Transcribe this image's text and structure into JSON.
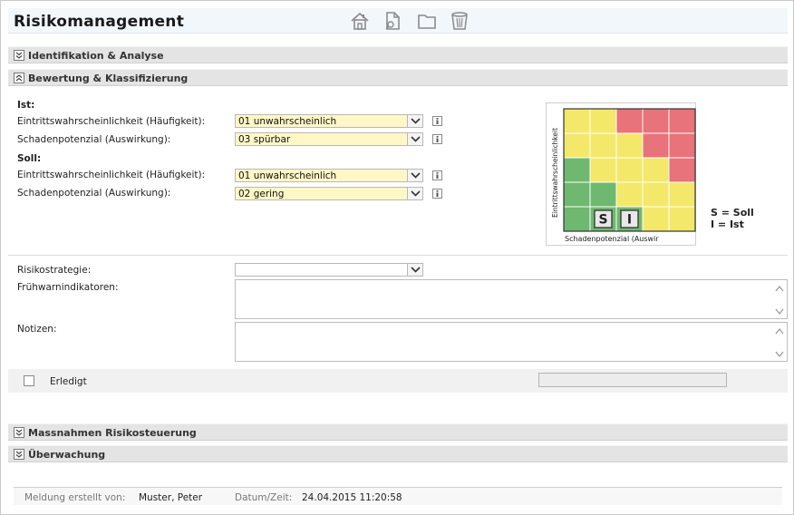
{
  "header": {
    "title": "Risikomanagement",
    "toolbar": [
      {
        "name": "home-icon"
      },
      {
        "name": "document-search-icon"
      },
      {
        "name": "folder-icon"
      },
      {
        "name": "trash-icon"
      }
    ]
  },
  "sections": {
    "identification": {
      "label": "Identifikation & Analyse",
      "state": "collapsed"
    },
    "assessment": {
      "label": "Bewertung & Klassifizierung",
      "state": "expanded"
    },
    "measures": {
      "label": "Massnahmen Risikosteuerung",
      "state": "collapsed"
    },
    "monitoring": {
      "label": "Überwachung",
      "state": "collapsed"
    }
  },
  "ist": {
    "heading": "Ist:",
    "probability_label": "Eintrittswahrscheinlichkeit (Häufigkeit):",
    "probability_value": "01 unwahrscheinlich",
    "impact_label": "Schadenpotenzial (Auswirkung):",
    "impact_value": "03 spürbar"
  },
  "soll": {
    "heading": "Soll:",
    "probability_label": "Eintrittswahrscheinlichkeit (Häufigkeit):",
    "probability_value": "01 unwahrscheinlich",
    "impact_label": "Schadenpotenzial (Auswirkung):",
    "impact_value": "02 gering"
  },
  "matrix": {
    "y_label": "Eintrittswahrscheinlichkeit",
    "x_label": "Schadenpotenzial (Auswir",
    "soll_marker": "S",
    "ist_marker": "I",
    "legend_soll": "S = Soll",
    "legend_ist": "I = Ist",
    "colors": {
      "green": "#6fb86f",
      "yellow": "#f3e86a",
      "red": "#e8737a"
    },
    "rows": [
      [
        "yellow",
        "yellow",
        "red",
        "red",
        "red"
      ],
      [
        "yellow",
        "yellow",
        "yellow",
        "red",
        "red"
      ],
      [
        "green",
        "yellow",
        "yellow",
        "yellow",
        "red"
      ],
      [
        "green",
        "green",
        "yellow",
        "yellow",
        "yellow"
      ],
      [
        "green",
        "green",
        "green",
        "yellow",
        "yellow"
      ]
    ],
    "soll_cell": {
      "row": 5,
      "col": 2
    },
    "ist_cell": {
      "row": 5,
      "col": 3
    }
  },
  "strategy": {
    "label": "Risikostrategie:",
    "value": ""
  },
  "early_warning": {
    "label": "Frühwarnindikatoren:",
    "value": ""
  },
  "notes": {
    "label": "Notizen:",
    "value": ""
  },
  "done": {
    "label": "Erledigt",
    "checked": false
  },
  "footer": {
    "created_by_label": "Meldung erstellt von:",
    "created_by_value": "Muster, Peter",
    "datetime_label": "Datum/Zeit:",
    "datetime_value": "24.04.2015 11:20:58"
  }
}
